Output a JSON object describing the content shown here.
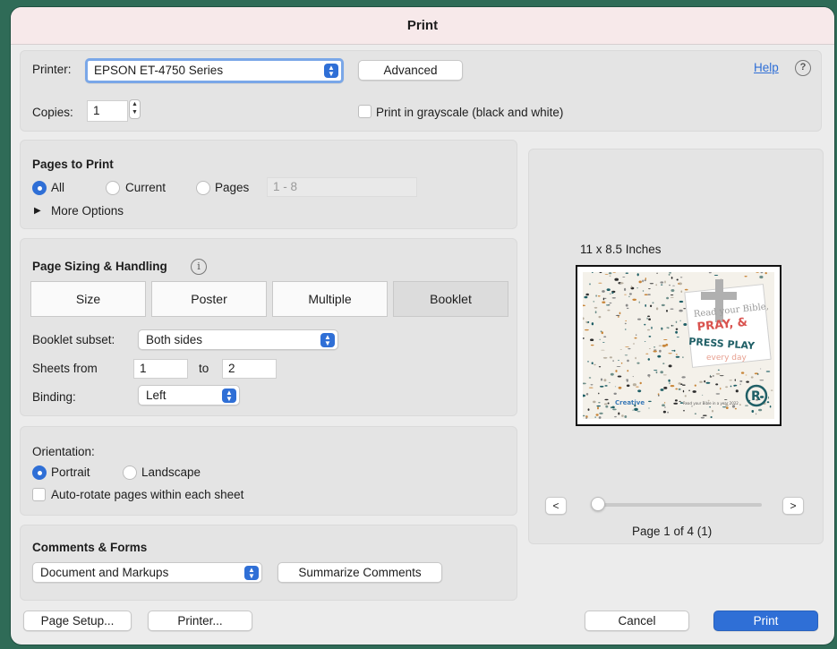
{
  "dialog": {
    "title": "Print"
  },
  "printer": {
    "label": "Printer:",
    "selected": "EPSON ET-4750 Series",
    "advanced_label": "Advanced",
    "help_label": "Help",
    "help_icon": "?"
  },
  "copies": {
    "label": "Copies:",
    "value": "1"
  },
  "grayscale": {
    "label": "Print in grayscale (black and white)",
    "checked": false
  },
  "pages_to_print": {
    "heading": "Pages to Print",
    "all_label": "All",
    "current_label": "Current",
    "pages_label": "Pages",
    "range_placeholder": "1 - 8",
    "selected": "All",
    "more_options_label": "More Options"
  },
  "sizing": {
    "heading": "Page Sizing & Handling",
    "info_icon": "i",
    "tabs": [
      "Size",
      "Poster",
      "Multiple",
      "Booklet"
    ],
    "active_tab": "Booklet",
    "booklet_subset_label": "Booklet subset:",
    "booklet_subset_value": "Both sides",
    "sheets_from_label": "Sheets from",
    "sheets_from_value": "1",
    "sheets_to_label": "to",
    "sheets_to_value": "2",
    "binding_label": "Binding:",
    "binding_value": "Left"
  },
  "orientation": {
    "heading": "Orientation:",
    "portrait_label": "Portrait",
    "landscape_label": "Landscape",
    "selected": "Portrait",
    "auto_rotate_label": "Auto-rotate pages within each sheet",
    "auto_rotate_checked": false
  },
  "comments": {
    "heading": "Comments & Forms",
    "selected": "Document and Markups",
    "summarize_label": "Summarize Comments"
  },
  "preview": {
    "size_label": "11 x 8.5 Inches",
    "prev_label": "<",
    "next_label": ">",
    "page_indicator": "Page 1 of 4 (1)",
    "slider_position": 0,
    "thumb": {
      "line1": "Read your Bible,",
      "line2": "PRAY, &",
      "line3": "PRESS PLAY",
      "line4": "every day",
      "brand": "Creative",
      "mark": "R",
      "footer": "Read your Bible in a year 2022"
    }
  },
  "footer": {
    "page_setup_label": "Page Setup...",
    "printer_label": "Printer...",
    "cancel_label": "Cancel",
    "print_label": "Print"
  },
  "colors": {
    "accent": "#2f6fd6",
    "title_bar": "#f7e9ea",
    "window_border": "#2f6b57",
    "thumb_red": "#d9534f",
    "thumb_teal": "#1f5f66"
  }
}
